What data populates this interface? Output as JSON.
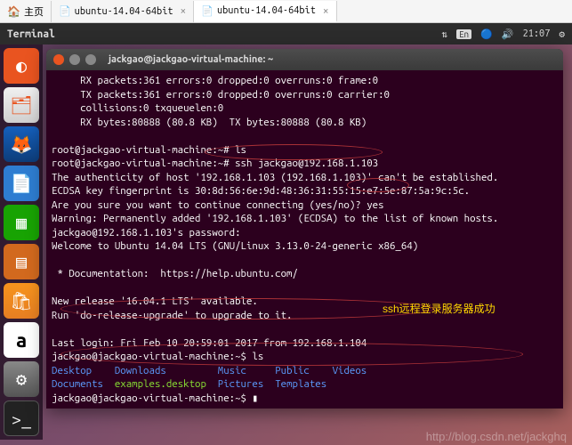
{
  "browser_tabs": [
    {
      "icon": "🏠",
      "label": "主页"
    },
    {
      "icon": "📄",
      "label": "ubuntu-14.04-64bit"
    },
    {
      "icon": "📄",
      "label": "ubuntu-14.04-64bit"
    }
  ],
  "topbar": {
    "title": "Terminal",
    "lang": "En",
    "time": "21:07",
    "icons": {
      "updown": "⇅",
      "bt": "🔵",
      "speaker": "🔊",
      "gear": "⚙"
    }
  },
  "launcher": {
    "ubuntu": "◐",
    "files": "🗂",
    "firefox": "🦊",
    "writer": "📄",
    "calc": "▦",
    "impress": "▤",
    "software": "🛍",
    "amazon": "a",
    "settings": "⚙",
    "terminal": ">_"
  },
  "term": {
    "title": "jackgao@jackgao-virtual-machine: ~",
    "l1": "     RX packets:361 errors:0 dropped:0 overruns:0 frame:0",
    "l2": "     TX packets:361 errors:0 dropped:0 overruns:0 carrier:0",
    "l3": "     collisions:0 txqueuelen:0",
    "l4": "     RX bytes:80888 (80.8 KB)  TX bytes:80888 (80.8 KB)",
    "p1": "root@jackgao-virtual-machine:~# ",
    "c1": "ls",
    "p2": "root@jackgao-virtual-machine:~# ",
    "c2": "ssh jackgao@192.168.1.103",
    "auth": "The authenticity of host '192.168.1.103 (192.168.1.103)' can't be established.",
    "ecdsa": "ECDSA key fingerprint is 30:8d:56:6e:9d:48:36:31:55:15:e7:5e:87:5a:9c:5c.",
    "sure": "Are you sure you want to continue connecting (yes/no)? ",
    "yes": "yes",
    "warn": "Warning: Permanently added '192.168.1.103' (ECDSA) to the list of known hosts.",
    "pwd": "jackgao@192.168.1.103's password:",
    "welcome": "Welcome to Ubuntu 14.04 LTS (GNU/Linux 3.13.0-24-generic x86_64)",
    "doc": " * Documentation:  https://help.ubuntu.com/",
    "newrel": "New release '16.04.1 LTS' available.",
    "upgrade": "Run 'do-release-upgrade' to upgrade to it.",
    "lastlogin": "Last login: Fri Feb 10 20:59:01 2017 from 192.168.1.104",
    "p3": "jackgao@jackgao-virtual-machine:~$ ",
    "c3": "ls",
    "ls_row1": {
      "a": "Desktop",
      "b": "Downloads",
      "c": "Music",
      "d": "Public",
      "e": "Videos"
    },
    "ls_row2": {
      "a": "Documents",
      "b": "examples.desktop",
      "c": "Pictures",
      "d": "Templates"
    },
    "p4": "jackgao@jackgao-virtual-machine:~$ ",
    "cursor": "▮"
  },
  "annotation": "ssh远程登录服务器成功",
  "watermark": "http://blog.csdn.net/jackghq"
}
